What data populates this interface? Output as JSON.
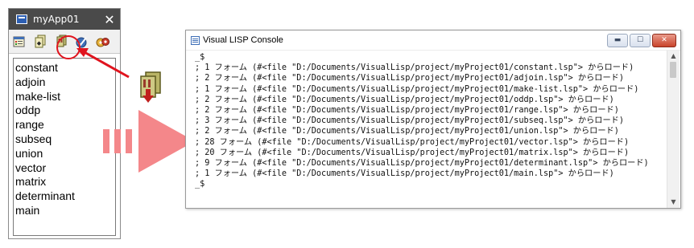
{
  "project_window": {
    "title": "myApp01",
    "close_glyph": "✕",
    "toolbar": [
      {
        "icon": "project-properties-icon"
      },
      {
        "icon": "load-source-files-icon"
      },
      {
        "icon": "load-project-fas-files-icon"
      },
      {
        "icon": "check-files-icon"
      },
      {
        "icon": "build-project-icon"
      }
    ],
    "files": [
      "constant",
      "adjoin",
      "make-list",
      "oddp",
      "range",
      "subseq",
      "union",
      "vector",
      "matrix",
      "determinant",
      "main"
    ]
  },
  "console_window": {
    "title": "Visual LISP Console",
    "buttons": {
      "minimize": "▬",
      "maximize": "☐",
      "close": "✕"
    },
    "lines": [
      "_$",
      "; 1 フォーム (#<file \"D:/Documents/VisualLisp/project/myProject01/constant.lsp\"> からロード)",
      "; 2 フォーム (#<file \"D:/Documents/VisualLisp/project/myProject01/adjoin.lsp\"> からロード)",
      "; 1 フォーム (#<file \"D:/Documents/VisualLisp/project/myProject01/make-list.lsp\"> からロード)",
      "; 2 フォーム (#<file \"D:/Documents/VisualLisp/project/myProject01/oddp.lsp\"> からロード)",
      "; 2 フォーム (#<file \"D:/Documents/VisualLisp/project/myProject01/range.lsp\"> からロード)",
      "; 3 フォーム (#<file \"D:/Documents/VisualLisp/project/myProject01/subseq.lsp\"> からロード)",
      "; 2 フォーム (#<file \"D:/Documents/VisualLisp/project/myProject01/union.lsp\"> からロード)",
      "; 28 フォーム (#<file \"D:/Documents/VisualLisp/project/myProject01/vector.lsp\"> からロード)",
      "; 20 フォーム (#<file \"D:/Documents/VisualLisp/project/myProject01/matrix.lsp\"> からロード)",
      "; 9 フォーム (#<file \"D:/Documents/VisualLisp/project/myProject01/determinant.lsp\"> からロード)",
      "; 1 フォーム (#<file \"D:/Documents/VisualLisp/project/myProject01/main.lsp\"> からロード)",
      "_$"
    ]
  },
  "colors": {
    "callout_red": "#e0141e",
    "arrow_pink": "#f4878a",
    "title_bar_dark": "#4a4a4a"
  }
}
